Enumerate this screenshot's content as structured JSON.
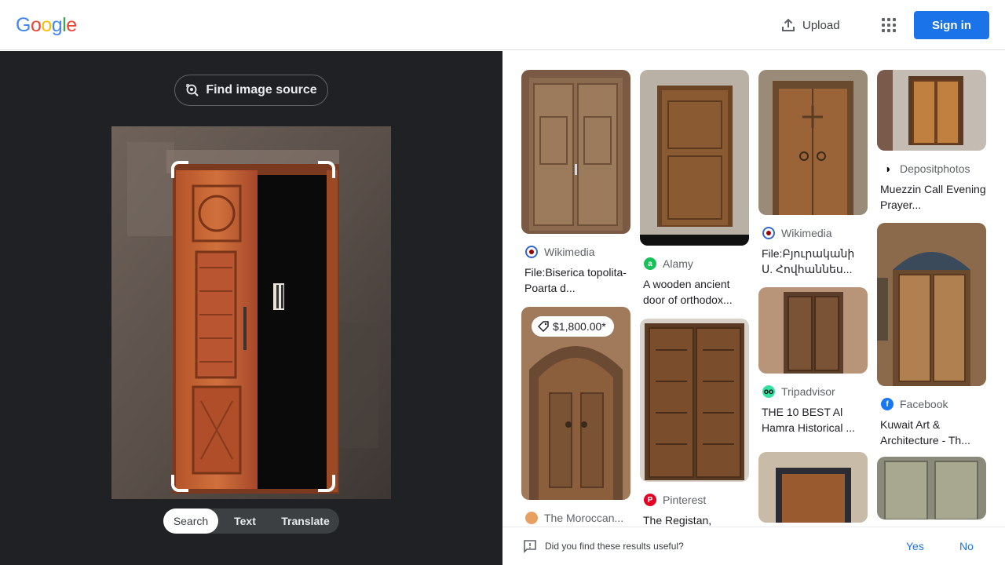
{
  "header": {
    "logo_letters": [
      "G",
      "o",
      "o",
      "g",
      "l",
      "e"
    ],
    "logo_colors": [
      "#4285f4",
      "#ea4335",
      "#fbbc05",
      "#4285f4",
      "#34a853",
      "#ea4335"
    ],
    "upload_label": "Upload",
    "upload_icon": "upload-icon",
    "apps_icon": "apps-grid-icon",
    "signin_label": "Sign in"
  },
  "lens": {
    "find_source_label": "Find image source",
    "find_source_icon": "lens-search-icon",
    "tabs": [
      {
        "label": "Search",
        "active": true
      },
      {
        "label": "Text",
        "active": false
      },
      {
        "label": "Translate",
        "active": false
      }
    ]
  },
  "results": {
    "columns": [
      [
        {
          "source": "Wikimedia",
          "icon": "wikimedia-icon",
          "title": "File:Biserica topolita-Poarta d..."
        },
        {
          "source": "The Moroccan...",
          "icon": "moroccan-icon",
          "title": "",
          "price": "$1,800.00*"
        }
      ],
      [
        {
          "source": "Alamy",
          "icon": "alamy-icon",
          "title": "A wooden ancient door of orthodox..."
        },
        {
          "source": "Pinterest",
          "icon": "pinterest-icon",
          "title": "The Registan,"
        }
      ],
      [
        {
          "source": "Wikimedia",
          "icon": "wikimedia-icon",
          "title": "File:Բյուրականի Ս. Հովհաննես..."
        },
        {
          "source": "Tripadvisor",
          "icon": "tripadvisor-icon",
          "title": "THE 10 BEST Al Hamra Historical ..."
        },
        {
          "source": "",
          "icon": "",
          "title": ""
        }
      ],
      [
        {
          "source": "Depositphotos",
          "icon": "depositphotos-icon",
          "title": "Muezzin Call Evening Prayer..."
        },
        {
          "source": "Facebook",
          "icon": "facebook-icon",
          "title": "Kuwait Art & Architecture - Th..."
        },
        {
          "source": "",
          "icon": "",
          "title": ""
        }
      ]
    ]
  },
  "feedback": {
    "question": "Did you find these results useful?",
    "icon": "feedback-icon",
    "yes_label": "Yes",
    "no_label": "No"
  },
  "colors": {
    "accent": "#1a73e8",
    "dark_panel": "#202124"
  }
}
